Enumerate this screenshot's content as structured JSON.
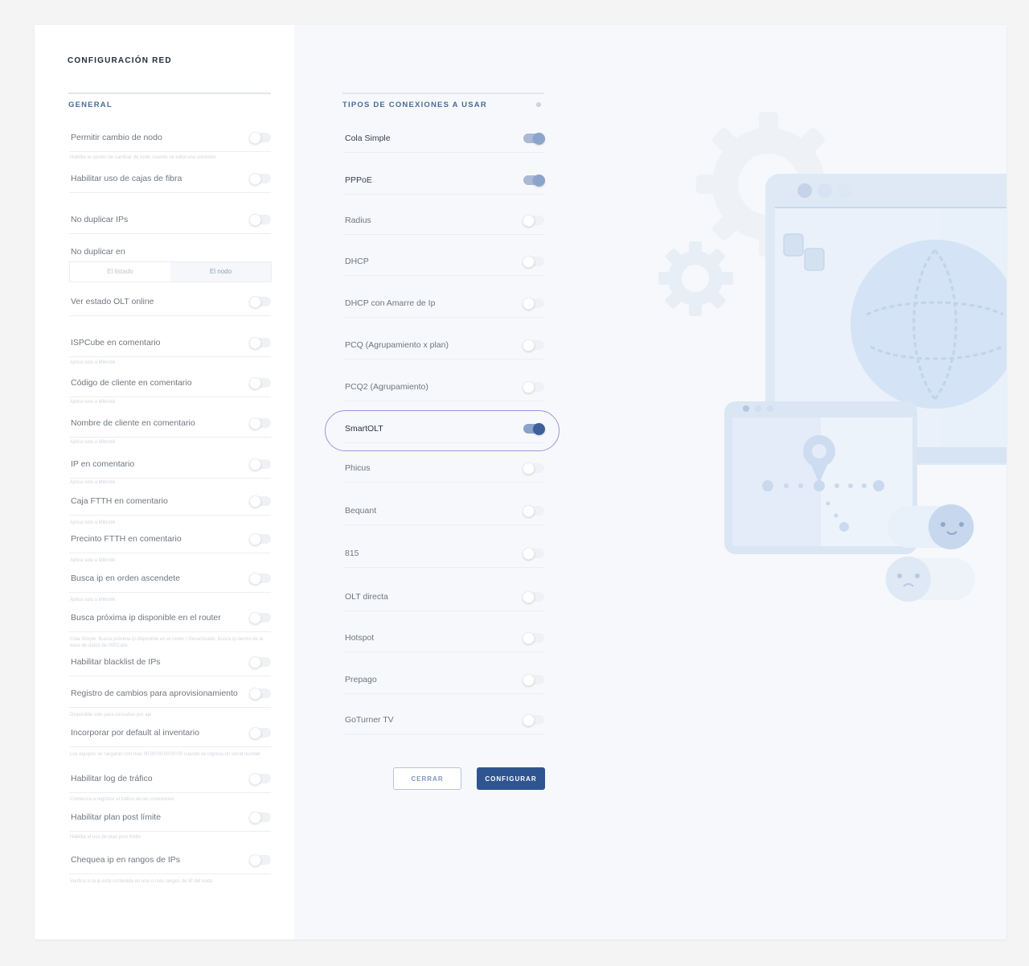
{
  "page": {
    "title": "CONFIGURACIÓN RED"
  },
  "general": {
    "heading": "GENERAL",
    "items": [
      {
        "label": "Permitir cambio de nodo",
        "hint": "Habilita la opción de cambiar de nodo cuando se edita una conexión",
        "on": false
      },
      {
        "label": "Habilitar uso de cajas de fibra",
        "hint": "",
        "on": false
      },
      {
        "label": "No duplicar IPs",
        "hint": "",
        "on": false
      },
      {
        "label": "Ver estado OLT online",
        "hint": "",
        "on": false
      },
      {
        "label": "ISPCube en comentario",
        "hint": "Aplica solo a Mikrotik",
        "on": false
      },
      {
        "label": "Código de cliente en comentario",
        "hint": "Aplica solo a Mikrotik",
        "on": false
      },
      {
        "label": "Nombre de cliente en comentario",
        "hint": "Aplica solo a Mikrotik",
        "on": false
      },
      {
        "label": "IP  en comentario",
        "hint": "Aplica solo a Mikrotik",
        "on": false
      },
      {
        "label": "Caja FTTH en comentario",
        "hint": "Aplica solo a Mikrotik",
        "on": false
      },
      {
        "label": "Precinto FTTH en comentario",
        "hint": "Aplica solo a Mikrotik",
        "on": false
      },
      {
        "label": "Busca ip en orden ascendete",
        "hint": "Aplica solo a Mikrotik",
        "on": false
      },
      {
        "label": "Busca próxima ip disponible en el router",
        "hint": "Cola Simple: Busca próxima ip disponible en el router / Desactivado: Busca ip dentro de la base de datos de ISPCube",
        "on": false
      },
      {
        "label": "Habilitar blacklist de IPs",
        "hint": "",
        "on": false
      },
      {
        "label": "Registro de cambios para aprovisionamiento",
        "hint": "Disponible solo para consultas por api",
        "on": false
      },
      {
        "label": "Incorporar por default al inventario",
        "hint": "Los equipos se cargarán con mac 00:00:00:00:00:00 cuando se ingresa un serial number",
        "on": false
      },
      {
        "label": "Habilitar log de tráfico",
        "hint": "Comienza a registrar el tráfico de las conexiones",
        "on": false
      },
      {
        "label": "Habilitar plan post límite",
        "hint": "Habilita el uso de plan post límite",
        "on": false
      },
      {
        "label": "Chequea ip en rangos de IPs",
        "hint": "Verifica si la ip está contenida en uno o más rangos de IP del nodo",
        "on": false
      }
    ],
    "no_duplicar_en": {
      "label": "No duplicar en",
      "options": [
        "El listado",
        "El nodo"
      ],
      "selected": "El nodo"
    }
  },
  "tipos": {
    "heading": "TIPOS DE CONEXIONES A USAR",
    "info_icon": "i",
    "items": [
      {
        "label": "Cola Simple",
        "on": true
      },
      {
        "label": "PPPoE",
        "on": true
      },
      {
        "label": "Radius",
        "on": false
      },
      {
        "label": "DHCP",
        "on": false
      },
      {
        "label": "DHCP con Amarre de Ip",
        "on": false
      },
      {
        "label": "PCQ (Agrupamiento x plan)",
        "on": false
      },
      {
        "label": "PCQ2  (Agrupamiento)",
        "on": false
      },
      {
        "label": "SmartOLT",
        "on": true,
        "highlighted": true
      },
      {
        "label": "Phicus",
        "on": false
      },
      {
        "label": "Bequant",
        "on": false
      },
      {
        "label": "815",
        "on": false
      },
      {
        "label": "OLT directa",
        "on": false
      },
      {
        "label": "Hotspot",
        "on": false
      },
      {
        "label": "Prepago",
        "on": false
      },
      {
        "label": "GoTurner TV",
        "on": false
      }
    ]
  },
  "buttons": {
    "close": "CERRAR",
    "configure": "CONFIGURAR"
  },
  "colors": {
    "accent": "#2f5590",
    "highlight_ring": "#9c96d6",
    "toggle_on": "#8ba4cc"
  }
}
